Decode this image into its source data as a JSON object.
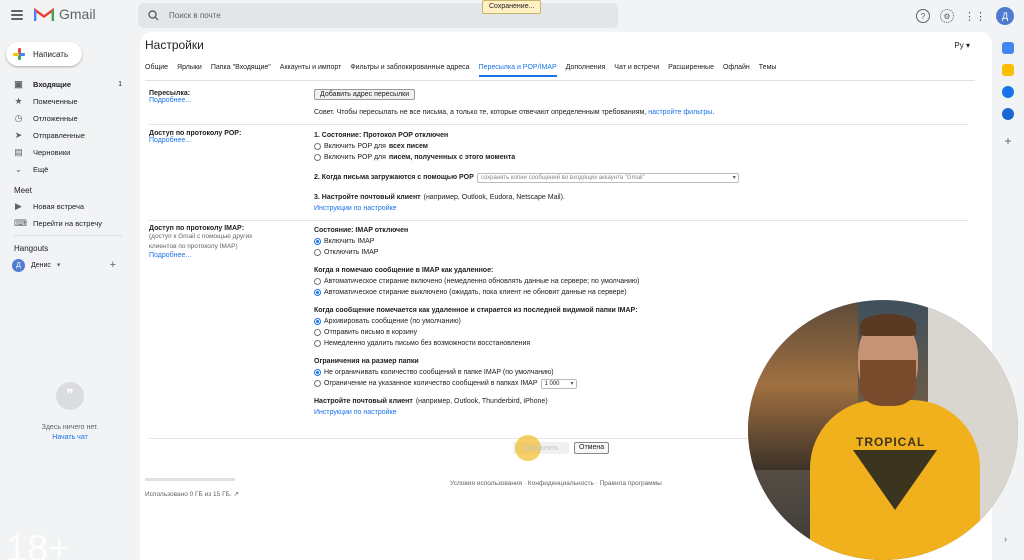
{
  "app": {
    "name": "Gmail",
    "brand_colors": [
      "#ea4335",
      "#fbbc04",
      "#34a853",
      "#4285f4"
    ]
  },
  "search": {
    "placeholder": "Поиск в почте"
  },
  "toast": {
    "text": "Сохранение..."
  },
  "top_icons": [
    "help-icon",
    "settings-gear-icon",
    "apps-grid-icon"
  ],
  "account": {
    "initial": "Д"
  },
  "compose": {
    "label": "Написать"
  },
  "nav": [
    {
      "label": "Входящие",
      "count": "1",
      "icon": "inbox-icon"
    },
    {
      "label": "Помеченные",
      "icon": "star-icon"
    },
    {
      "label": "Отложенные",
      "icon": "clock-icon"
    },
    {
      "label": "Отправленные",
      "icon": "send-icon"
    },
    {
      "label": "Черновики",
      "icon": "draft-icon"
    },
    {
      "label": "Ещё",
      "icon": "chevron-down-icon"
    }
  ],
  "meet": {
    "title": "Meet",
    "items": [
      "Новая встреча",
      "Перейти на встречу"
    ]
  },
  "hangouts": {
    "title": "Hangouts",
    "user_initial": "Д",
    "user": "Денис"
  },
  "empty_chat": {
    "text": "Здесь ничего нет.",
    "link": "Начать чат"
  },
  "overlay": {
    "rating": "18+"
  },
  "page": {
    "title": "Настройки",
    "lang": "Ру"
  },
  "tabs": [
    "Общие",
    "Ярлыки",
    "Папка \"Входящие\"",
    "Аккаунты и импорт",
    "Фильтры и заблокированные адреса",
    "Пересылка и POP/IMAP",
    "Дополнения",
    "Чат и встречи",
    "Расширенные",
    "Офлайн",
    "Темы"
  ],
  "active_tab": "Пересылка и POP/IMAP",
  "forwarding": {
    "label": "Пересылка:",
    "more": "Подробнее...",
    "button": "Добавить адрес пересылки",
    "tip": "Совет. Чтобы пересылать не все письма, а только те, которые отвечают определенным требованиям,",
    "tip_link": "настройте фильтры",
    "tip_end": "."
  },
  "pop": {
    "label": "Доступ по протоколу POP:",
    "more": "Подробнее...",
    "status": "1. Состояние: Протокол POP отключен",
    "opt1_pre": "Включить POP для ",
    "opt1_bold": "всех писем",
    "opt2_pre": "Включить POP для ",
    "opt2_bold": "писем, полученных с этого момента",
    "step2": "2. Когда письма загружаются с помощью POP",
    "step2_select": "сохранять копии сообщений во входящих аккаунта \"Gmail\"",
    "step3_bold": "3. Настройте почтовый клиент",
    "step3_rest": " (например, Outlook, Eudora, Netscape Mail).",
    "instructions": "Инструкции по настройке"
  },
  "imap": {
    "label": "Доступ по протоколу IMAP:",
    "desc": "(доступ к Gmail с помощью других клиентов по протоколу IMAP)",
    "more": "Подробнее...",
    "status": "Состояние: IMAP отключен",
    "enable": "Включить IMAP",
    "disable": "Отключить IMAP",
    "delete_title": "Когда я помечаю сообщение в IMAP как удаленное:",
    "delete_opt1": "Автоматическое стирание включено (немедленно обновлять данные на сервере; по умолчанию)",
    "delete_opt2": "Автоматическое стирание выключено (ожидать, пока клиент не обновит данные на сервере)",
    "expunge_title": "Когда сообщение помечается как удаленное и стирается из последней видимой папки IMAP:",
    "expunge_opt1": "Архивировать сообщение (по умолчанию)",
    "expunge_opt2": "Отправить письмо в корзину",
    "expunge_opt3": "Немедленно удалить письмо без возможности восстановления",
    "limit_title": "Ограничения на размер папки",
    "limit_opt1": "Не ограничивать количество сообщений в папке IMAP (по умолчанию)",
    "limit_opt2": "Ограничение на указанное количество сообщений в папках IMAP",
    "limit_value": "1 000",
    "client_bold": "Настройте почтовый клиент",
    "client_rest": " (например, Outlook, Thunderbird, iPhone)",
    "instructions": "Инструкции по настройке"
  },
  "actions": {
    "save": "Сохранить",
    "cancel": "Отмена"
  },
  "footer": {
    "storage": "Использовано 0 ГБ из 15 ГБ.",
    "links": "Условия использования · Конфиденциальность · Правила программы"
  },
  "shirt": {
    "text": "TROPICAL"
  }
}
